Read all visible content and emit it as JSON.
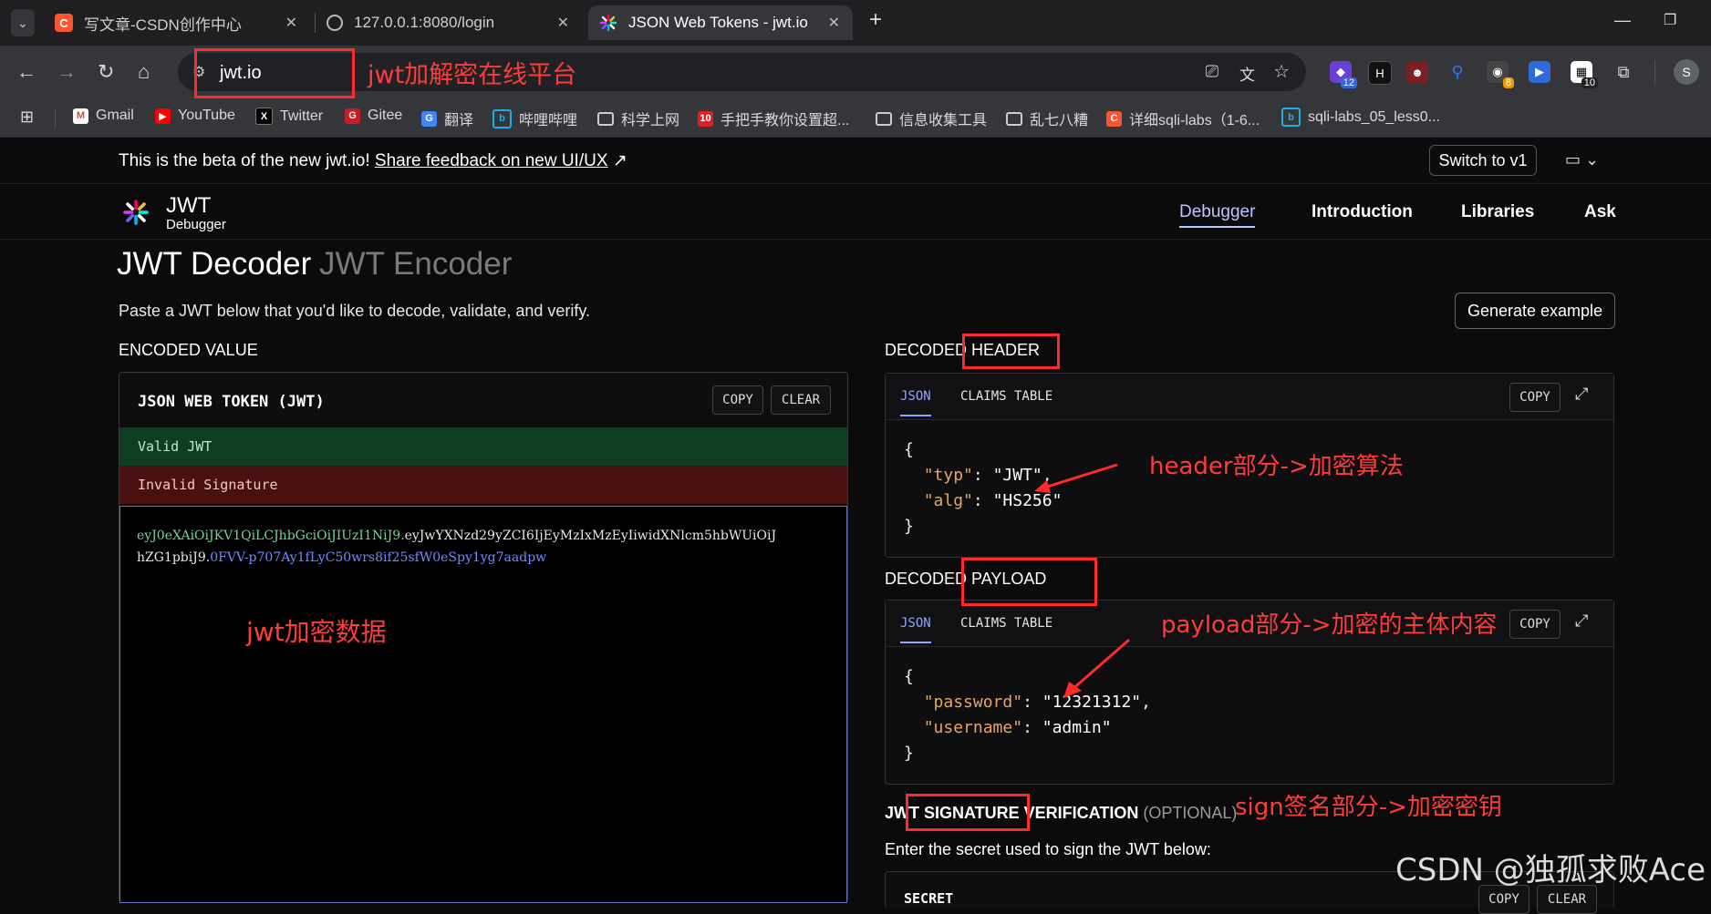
{
  "browser": {
    "tabs": [
      {
        "title": "写文章-CSDN创作中心",
        "icon": "C"
      },
      {
        "title": "127.0.0.1:8080/login",
        "icon": "globe-icon"
      },
      {
        "title": "JSON Web Tokens - jwt.io",
        "icon": "jwt-icon"
      }
    ],
    "url": "jwt.io",
    "extensions_badges": [
      "12",
      "8",
      "10"
    ],
    "profile_initial": "S"
  },
  "bookmarks": [
    {
      "label": "Gmail"
    },
    {
      "label": "YouTube"
    },
    {
      "label": "Twitter"
    },
    {
      "label": "Gitee"
    },
    {
      "label": "翻译"
    },
    {
      "label": "哔哩哔哩"
    },
    {
      "label": "科学上网"
    },
    {
      "label": "手把手教你设置超..."
    },
    {
      "label": "信息收集工具"
    },
    {
      "label": "乱七八糟"
    },
    {
      "label": "详细sqli-labs（1-6..."
    },
    {
      "label": "sqli-labs_05_less0..."
    }
  ],
  "banner": {
    "text": "This is the beta of the new jwt.io!",
    "link": "Share feedback on new UI/UX",
    "link_arrow": "↗",
    "switch_label": "Switch to v1"
  },
  "site": {
    "brand": "JWT",
    "brand_sub": "Debugger",
    "nav": [
      "Debugger",
      "Introduction",
      "Libraries",
      "Ask"
    ]
  },
  "main": {
    "title_decoder": "JWT Decoder",
    "title_encoder": "JWT Encoder",
    "intro": "Paste a JWT below that you'd like to decode, validate, and verify.",
    "generate_label": "Generate example",
    "encoded_label": "ENCODED VALUE",
    "jwt_panel_title": "JSON WEB TOKEN (JWT)",
    "copy": "COPY",
    "clear": "CLEAR",
    "valid": "Valid JWT",
    "invalid": "Invalid Signature",
    "token_line1_header": "eyJ0eXAiOiJKV1QiLCJhbGciOiJIUzI1NiJ9.",
    "token_line1_payload": "eyJwYXNzd29yZCI6IjEyMzIxMzEyIiwidXNlcm5hbWUiOiJ",
    "token_line2_payload": "hZG1pbiJ9.",
    "token_line2_signature": "0FVV-p707Ay1fLyC50wrs8if25sfW0eSpy1yg7aadpw",
    "decoded_header_label_a": "DECODED",
    "decoded_header_label_b": "HEADER",
    "decoded_payload_label_a": "DECODED",
    "decoded_payload_label_b": "PAYLOAD",
    "tab_json": "JSON",
    "tab_claims": "CLAIMS TABLE",
    "header_json": {
      "open": "{",
      "typ_key": "\"typ\"",
      "typ_val": "\"JWT\"",
      "alg_key": "\"alg\"",
      "alg_val": "\"HS256\"",
      "close": "}"
    },
    "payload_json": {
      "open": "{",
      "password_key": "\"password\"",
      "password_val": "\"12321312\"",
      "username_key": "\"username\"",
      "username_val": "\"admin\"",
      "close": "}"
    },
    "sig_label_a": "JWT SIGNATURE VERIFICATION",
    "sig_label_b": "(OPTIONAL)",
    "sig_intro": "Enter the secret used to sign the JWT below:",
    "secret_label": "SECRET"
  },
  "annotations": {
    "url_note": "jwt加解密在线平台",
    "header_note": "header部分->加密算法",
    "payload_note": "payload部分->加密的主体内容",
    "data_note": "jwt加密数据",
    "sign_note": "sign签名部分->加密密钥"
  },
  "watermark": "CSDN @独孤求败Ace",
  "colors": {
    "annotation_red": "#ff2b2b",
    "token_header": "#6fd49a",
    "token_payload": "#e6e6e6",
    "token_signature": "#6f8cff",
    "valid_bg": "#0f3d1f",
    "invalid_bg": "#4a1010",
    "json_key": "#e7a65b"
  }
}
